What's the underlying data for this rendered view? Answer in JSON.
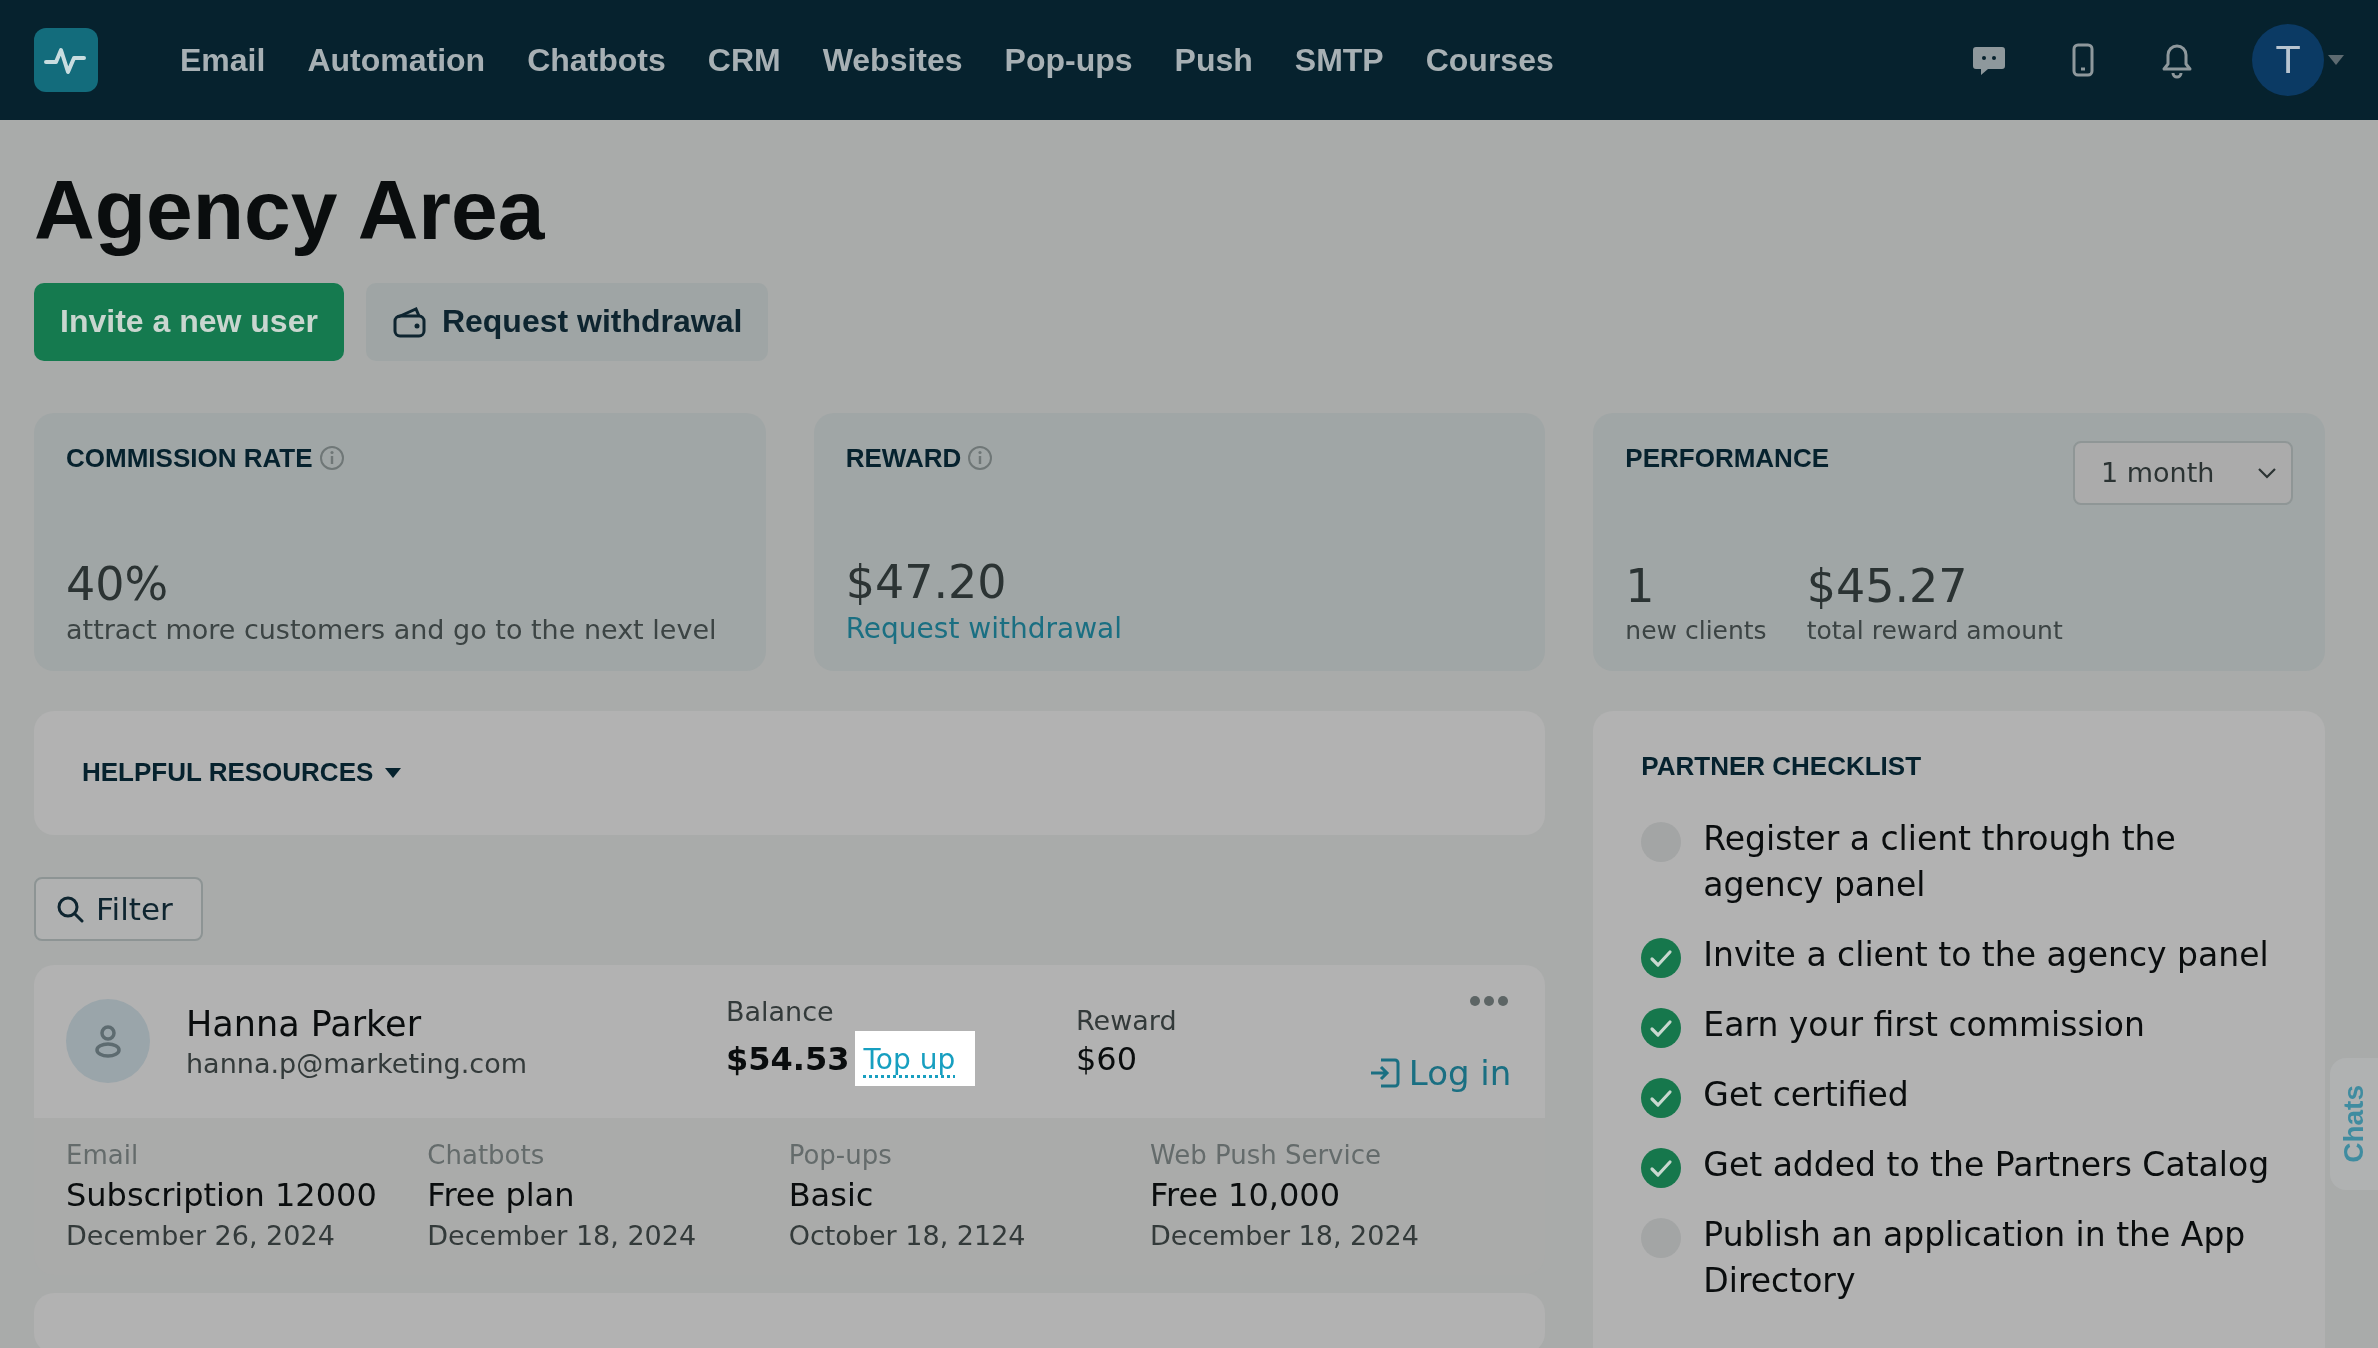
{
  "nav": {
    "items": [
      {
        "label": "Email"
      },
      {
        "label": "Automation"
      },
      {
        "label": "Chatbots"
      },
      {
        "label": "CRM"
      },
      {
        "label": "Websites"
      },
      {
        "label": "Pop-ups"
      },
      {
        "label": "Push"
      },
      {
        "label": "SMTP"
      },
      {
        "label": "Courses"
      }
    ],
    "avatar": "T"
  },
  "title": "Agency Area",
  "actions": [
    {
      "label": "Invite a new user",
      "kind": "primary"
    },
    {
      "label": "Request withdrawal",
      "kind": "secondary"
    }
  ],
  "commission": {
    "title": "COMMISSION RATE",
    "value": "40%",
    "note": "attract more customers and go to the next level"
  },
  "reward": {
    "title": "REWARD",
    "value": "$47.20",
    "link": "Request withdrawal"
  },
  "performance": {
    "title": "PERFORMANCE",
    "period": "1 month",
    "metrics": [
      {
        "value": "1",
        "label": "new clients"
      },
      {
        "value": "$45.27",
        "label": "total reward amount"
      }
    ]
  },
  "resources": {
    "title": "HELPFUL RESOURCES"
  },
  "filter": {
    "label": "Filter"
  },
  "clients": [
    {
      "name": "Hanna Parker",
      "email": "hanna.p@marketing.com",
      "balance_label": "Balance",
      "balance": "$54.53",
      "top_up": "Top up",
      "reward_label": "Reward",
      "reward": "$60",
      "login": "Log in",
      "services": [
        {
          "service": "Email",
          "plan": "Subscription 12000",
          "date": "December 26, 2024"
        },
        {
          "service": "Chatbots",
          "plan": "Free plan",
          "date": "December 18, 2024"
        },
        {
          "service": "Pop-ups",
          "plan": "Basic",
          "date": "October 18, 2124"
        },
        {
          "service": "Web Push Service",
          "plan": "Free 10,000",
          "date": "December 18, 2024"
        }
      ]
    }
  ],
  "checklist": {
    "title": "PARTNER CHECKLIST",
    "items": [
      {
        "label": "Register a client through the agency panel",
        "checked": false
      },
      {
        "label": "Invite a client to the agency panel",
        "checked": true
      },
      {
        "label": "Earn your first commission",
        "checked": true
      },
      {
        "label": "Get certified",
        "checked": true
      },
      {
        "label": "Get added to the Partners Catalog",
        "checked": true
      },
      {
        "label": "Publish an application in the App Directory",
        "checked": false
      }
    ]
  },
  "chats_tab": "Chats"
}
